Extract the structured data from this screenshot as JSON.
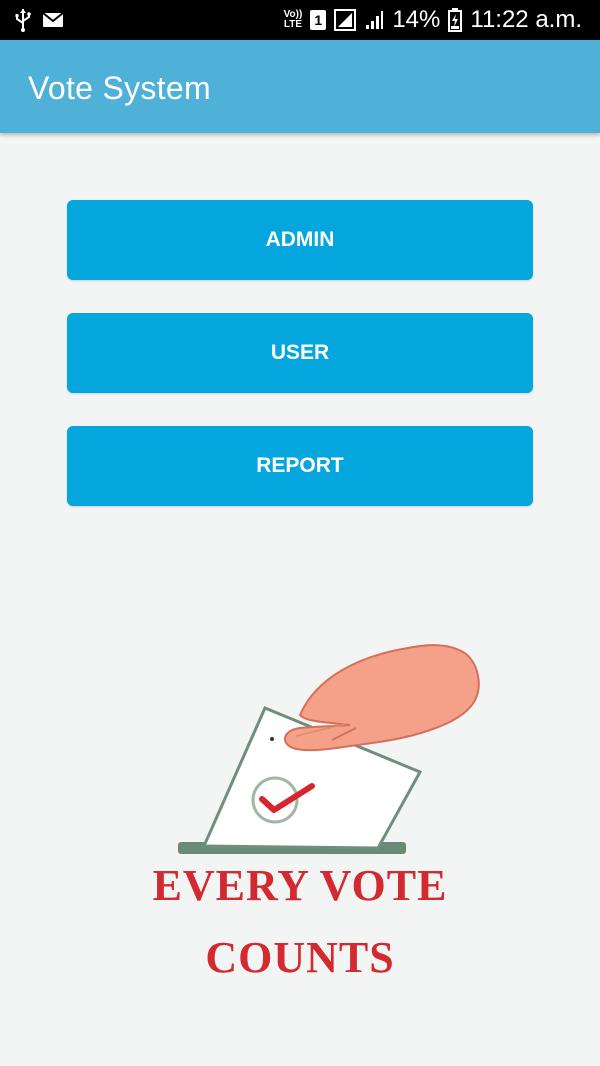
{
  "status_bar": {
    "volte_top": "Vo))",
    "volte_bottom": "LTE",
    "sim_slot": "1",
    "battery": "14%",
    "time": "11:22 a.m.",
    "icons": [
      "usb-icon",
      "mail-icon",
      "volte-icon",
      "sim-icon",
      "no-sim-icon",
      "signal-icon",
      "battery-icon"
    ]
  },
  "app_bar": {
    "title": "Vote System"
  },
  "buttons": {
    "admin": "ADMIN",
    "user": "USER",
    "report": "REPORT"
  },
  "illustration": {
    "line1": "EVERY VOTE",
    "line2": "COUNTS"
  },
  "colors": {
    "app_bar": "#4fb0d8",
    "button": "#05a6de",
    "slogan": "#d22a30",
    "background": "#f3f4f4"
  }
}
